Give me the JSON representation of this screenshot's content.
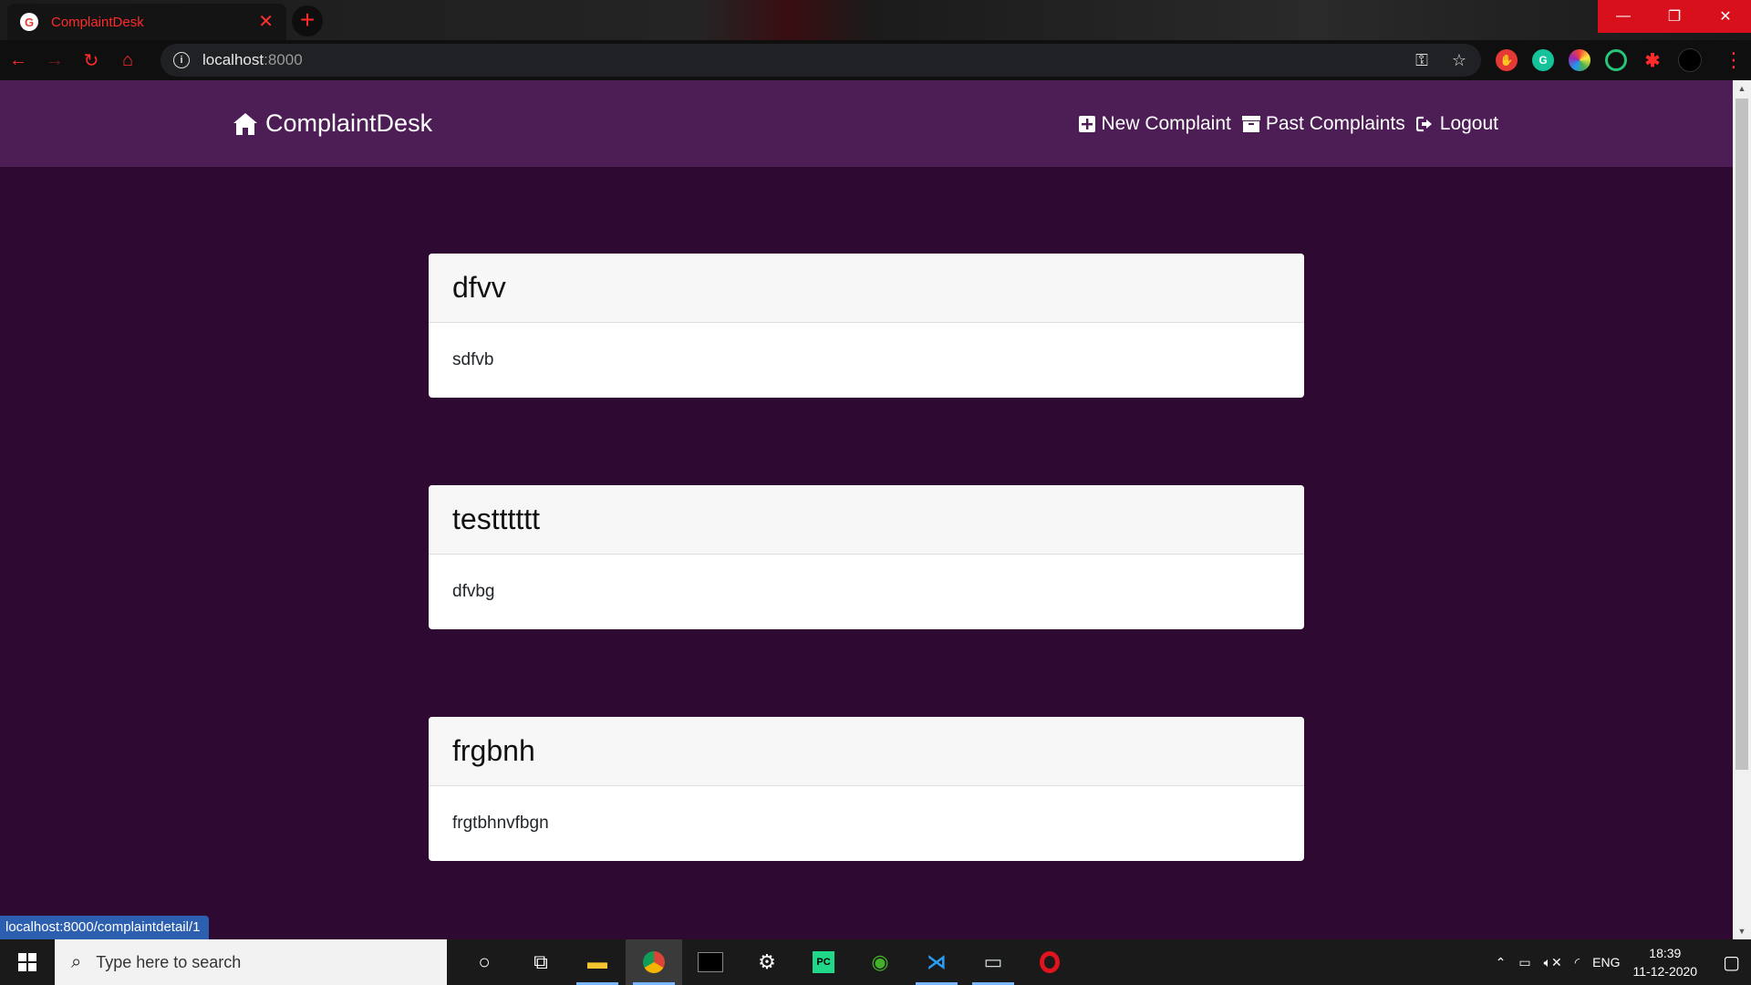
{
  "browser": {
    "tab_title": "ComplaintDesk",
    "tab_favicon": "G",
    "url_host": "localhost",
    "url_port": ":8000",
    "status_link": "localhost:8000/complaintdetail/1"
  },
  "navbar": {
    "brand": "ComplaintDesk",
    "links": [
      {
        "label": "New Complaint",
        "icon": "plus-square-icon"
      },
      {
        "label": "Past Complaints",
        "icon": "archive-icon"
      },
      {
        "label": "Logout",
        "icon": "sign-out-icon"
      }
    ]
  },
  "complaints": [
    {
      "title": "dfvv",
      "body": "sdfvb"
    },
    {
      "title": "testttttt",
      "body": "dfvbg"
    },
    {
      "title": "frgbnh",
      "body": "frgtbhnvfbgn"
    }
  ],
  "taskbar": {
    "search_placeholder": "Type here to search",
    "language": "ENG",
    "time": "18:39",
    "date": "11-12-2020"
  },
  "colors": {
    "page_bg": "#2e0a33",
    "navbar_bg": "#4d1d55",
    "card_header_bg": "#f7f7f7"
  }
}
